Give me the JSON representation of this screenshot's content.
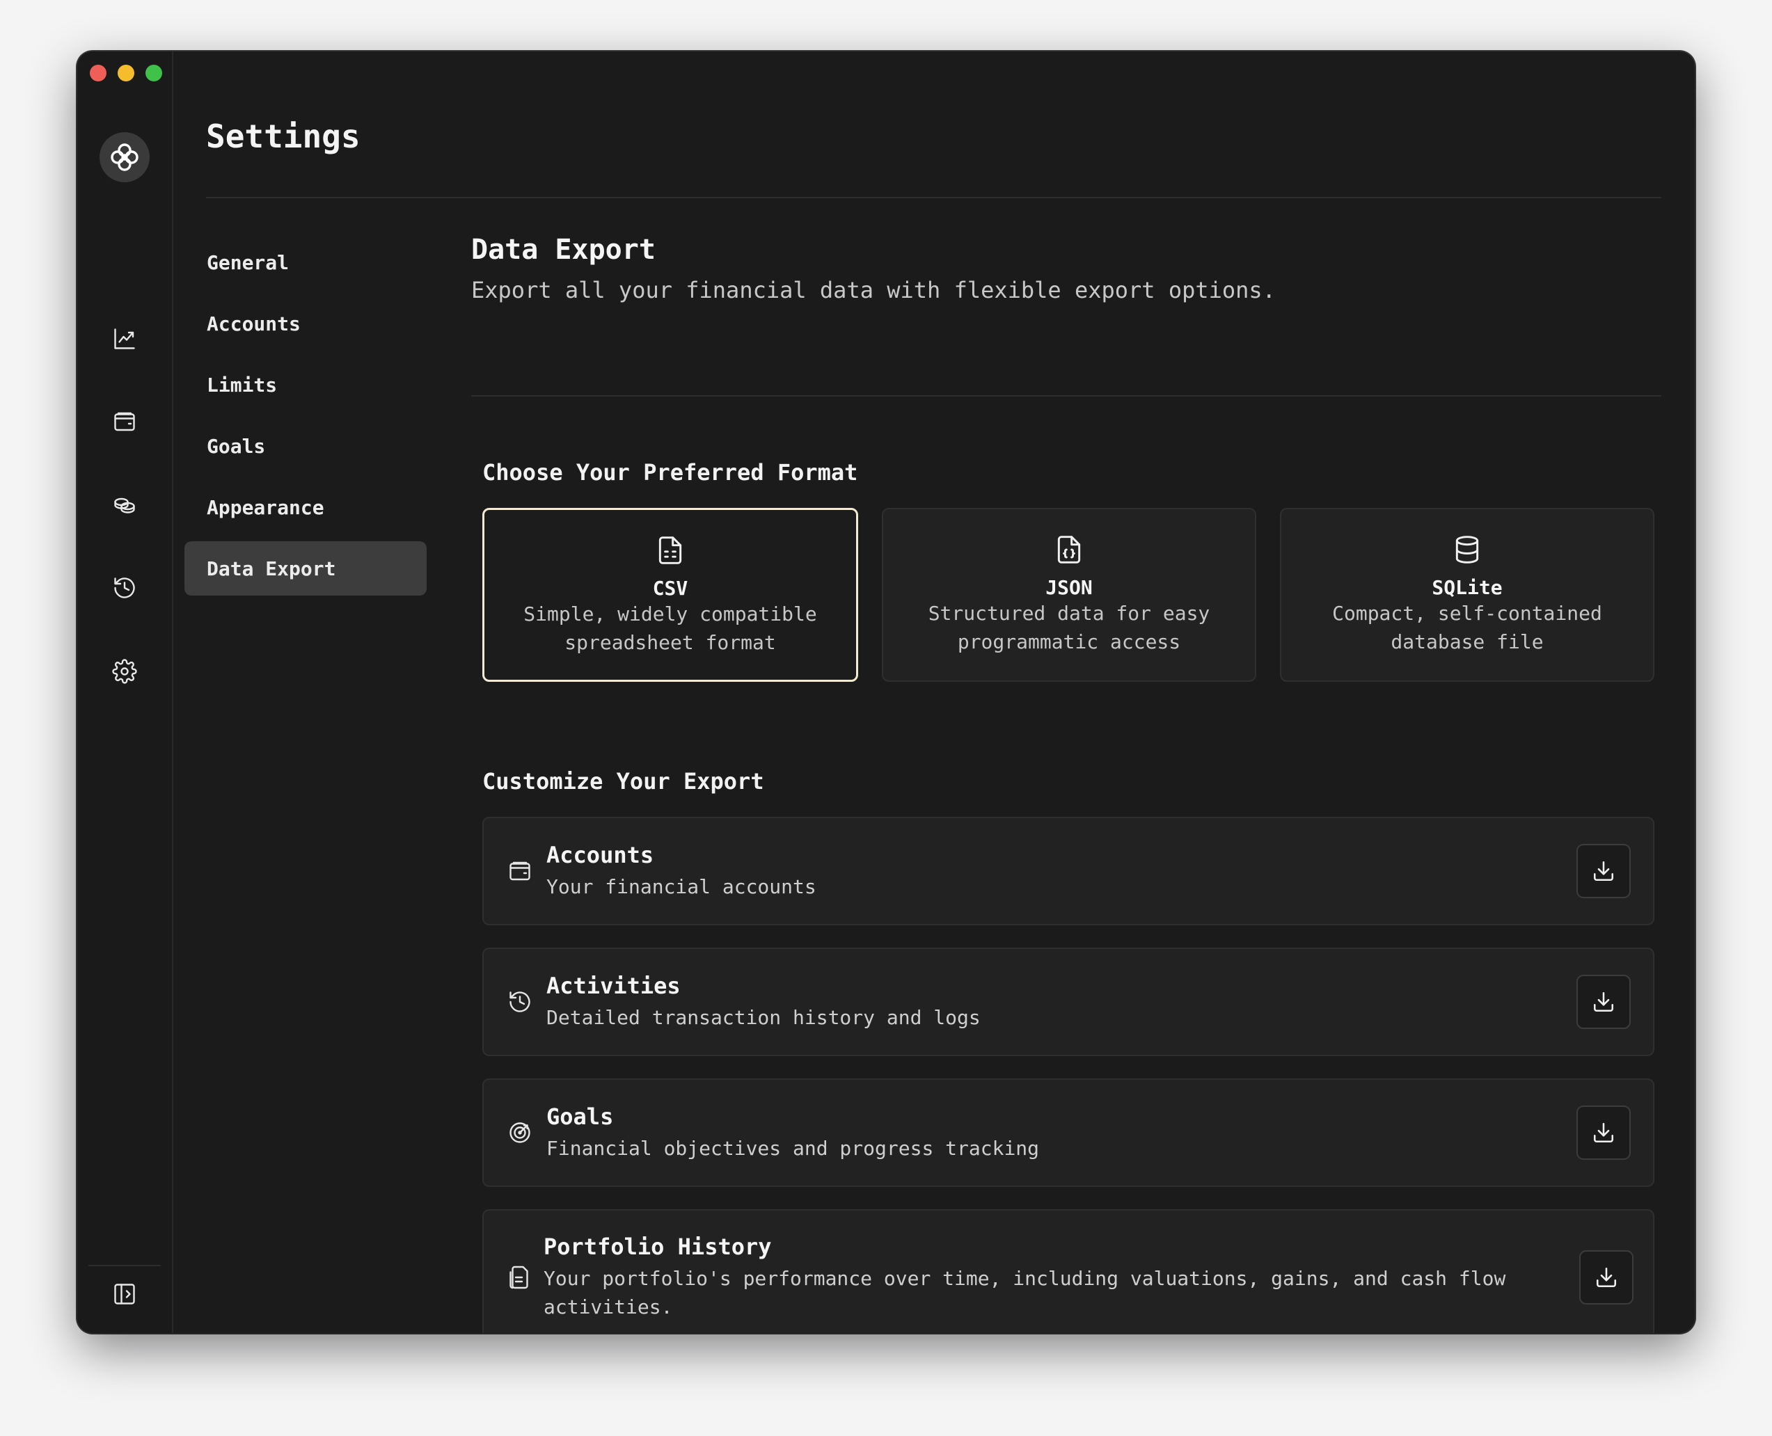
{
  "window": {
    "title": "Settings"
  },
  "rail": {
    "items": [
      {
        "name": "chart-icon",
        "label": "Performance"
      },
      {
        "name": "wallet-icon",
        "label": "Accounts"
      },
      {
        "name": "coins-icon",
        "label": "Holdings"
      },
      {
        "name": "history-icon",
        "label": "Activities"
      },
      {
        "name": "gear-icon",
        "label": "Settings"
      }
    ],
    "toggle_icon": "sidebar-toggle-icon"
  },
  "nav": {
    "items": [
      "General",
      "Accounts",
      "Limits",
      "Goals",
      "Appearance",
      "Data Export"
    ],
    "active": "Data Export"
  },
  "section": {
    "title": "Data Export",
    "subtitle": "Export all your financial data with flexible export options."
  },
  "formats": {
    "heading": "Choose Your Preferred Format",
    "selected": "CSV",
    "items": [
      {
        "name": "CSV",
        "desc": "Simple, widely compatible spreadsheet format",
        "icon": "file-spreadsheet-icon"
      },
      {
        "name": "JSON",
        "desc": "Structured data for easy programmatic access",
        "icon": "file-json-icon"
      },
      {
        "name": "SQLite",
        "desc": "Compact, self-contained database file",
        "icon": "database-icon"
      }
    ]
  },
  "customize": {
    "heading": "Customize Your Export",
    "items": [
      {
        "title": "Accounts",
        "desc": "Your financial accounts",
        "icon": "wallet-icon"
      },
      {
        "title": "Activities",
        "desc": "Detailed transaction history and logs",
        "icon": "history-icon"
      },
      {
        "title": "Goals",
        "desc": "Financial objectives and progress tracking",
        "icon": "target-icon"
      },
      {
        "title": "Portfolio History",
        "desc": "Your portfolio's performance over time, including valuations, gains, and cash flow activities.",
        "icon": "file-text-icon"
      }
    ],
    "download_icon": "download-icon"
  },
  "colors": {
    "background": "#1b1b1b",
    "card": "#222222",
    "selected_border": "#f3ead2",
    "active_nav": "#3d3d3d"
  }
}
